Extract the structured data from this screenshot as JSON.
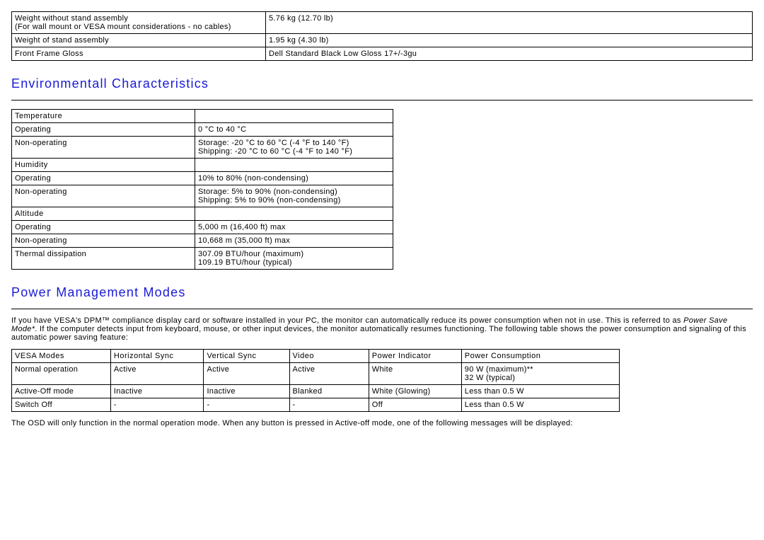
{
  "topTable": {
    "rows": [
      {
        "l1": "Weight without stand assembly",
        "l2": "(For wall mount or VESA mount considerations - no cables)",
        "v": "5.76 kg (12.70 lb)"
      },
      {
        "l1": "Weight of stand assembly",
        "l2": "",
        "v": "1.95 kg (4.30 lb)"
      },
      {
        "l1": "Front Frame Gloss",
        "l2": "",
        "v": "Dell Standard Black  Low Gloss 17+/-3gu"
      }
    ],
    "col1w": "350px"
  },
  "env": {
    "title": "Environmentall Characteristics",
    "rows": [
      {
        "l": "Temperature",
        "v": "",
        "hdr": true
      },
      {
        "l": "Operating",
        "v": "0 °C to 40 °C"
      },
      {
        "l": "Non-operating",
        "v": "Storage: -20 °C to 60 °C (-4 °F to 140 °F)\nShipping: -20 °C to 60 °C (-4 °F to 140 °F)"
      },
      {
        "l": "Humidity",
        "v": "",
        "hdr": true
      },
      {
        "l": "Operating",
        "v": "10% to 80% (non-condensing)"
      },
      {
        "l": "Non-operating",
        "v": "Storage: 5% to 90% (non-condensing)\nShipping: 5% to 90% (non-condensing)"
      },
      {
        "l": "Altitude",
        "v": "",
        "hdr": true
      },
      {
        "l": "Operating",
        "v": "5,000 m (16,400 ft) max"
      },
      {
        "l": "Non-operating",
        "v": "10,668 m (35,000 ft) max"
      },
      {
        "l": "Thermal dissipation",
        "v": "307.09 BTU/hour (maximum)\n109.19 BTU/hour (typical)"
      }
    ],
    "col1w": "250px"
  },
  "power": {
    "title": "Power Management Modes",
    "intro1": "If you have VESA's DPM™ compliance display card or software installed in your PC, the monitor can automatically reduce its power consumption when not in use. This is referred to as ",
    "introItalic": "Power Save Mode*",
    "intro2": ". If the computer detects input from keyboard, mouse, or other input devices, the monitor automatically resumes functioning. The following table shows the power consumption and signaling of this automatic power saving feature:",
    "headers": [
      "VESA Modes",
      "Horizontal Sync",
      "Vertical Sync",
      "Video",
      "Power Indicator",
      "Power Consumption"
    ],
    "rows": [
      [
        "Normal operation",
        "Active",
        "Active",
        "Active",
        "White",
        "90 W (maximum)**\n32 W (typical)"
      ],
      [
        "Active-Off mode",
        "Inactive",
        "Inactive",
        "Blanked",
        "White (Glowing)",
        "Less than 0.5 W"
      ],
      [
        "Switch Off",
        "-",
        "-",
        "-",
        "Off",
        "Less than 0.5 W"
      ]
    ],
    "colWidths": [
      "140px",
      "130px",
      "120px",
      "110px",
      "130px",
      "230px"
    ],
    "footnote": "The OSD will only function in the normal operation mode. When any button is pressed in Active-off mode, one of the following messages will be displayed:"
  }
}
